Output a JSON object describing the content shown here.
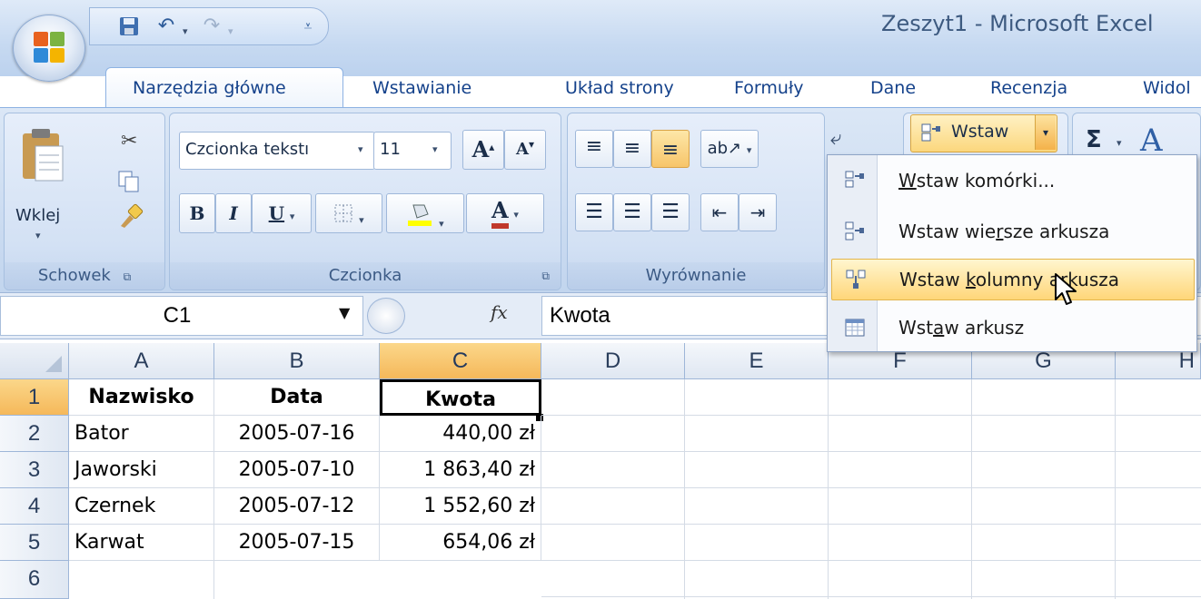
{
  "window": {
    "title": "Zeszyt1 - Microsoft Excel"
  },
  "quick_access": {
    "save_icon": "save-icon",
    "undo_icon": "undo-icon",
    "redo_icon": "redo-icon",
    "customize_icon": "customize-arrow-icon"
  },
  "tabs": [
    "Narzędzia główne",
    "Wstawianie",
    "Układ strony",
    "Formuły",
    "Dane",
    "Recenzja",
    "Widok"
  ],
  "tabs_visible": [
    "Narzędzia główne",
    "Wstawianie",
    "Układ strony",
    "Formuły",
    "Dane",
    "Recenzja",
    "Widol"
  ],
  "active_tab": "Narzędzia główne",
  "ribbon": {
    "clipboard": {
      "paste_label": "Wklej",
      "group_label": "Schowek"
    },
    "font": {
      "font_name": "Czcionka tekstu",
      "font_name_visible": "Czcionka tekstı",
      "font_size": "11",
      "bold": "B",
      "italic": "I",
      "underline": "U",
      "grow": "A",
      "shrink": "A",
      "font_color": "A",
      "group_label": "Czcionka"
    },
    "alignment": {
      "group_label": "Wyrównanie"
    },
    "cells": {
      "insert_label": "Wstaw"
    },
    "editing": {
      "sum_symbol": "Σ"
    }
  },
  "formula_bar": {
    "name_box": "C1",
    "fx": "fx",
    "formula": "Kwota"
  },
  "columns": [
    "A",
    "B",
    "C",
    "D",
    "E",
    "F",
    "G",
    "H"
  ],
  "selected_column": "C",
  "rows": [
    {
      "num": "1",
      "cells": [
        "Nazwisko",
        "Data",
        "Kwota"
      ]
    },
    {
      "num": "2",
      "cells": [
        "Bator",
        "2005-07-16",
        "440,00 zł"
      ]
    },
    {
      "num": "3",
      "cells": [
        "Jaworski",
        "2005-07-10",
        "1 863,40 zł"
      ]
    },
    {
      "num": "4",
      "cells": [
        "Czernek",
        "2005-07-12",
        "1 552,60 zł"
      ]
    },
    {
      "num": "5",
      "cells": [
        "Karwat",
        "2005-07-15",
        "654,06 zł"
      ]
    },
    {
      "num": "6",
      "cells": [
        "",
        "",
        ""
      ]
    }
  ],
  "insert_menu": {
    "items": [
      {
        "pre": "",
        "u": "W",
        "post": "staw komórki..."
      },
      {
        "pre": "Wstaw wie",
        "u": "r",
        "post": "sze arkusza"
      },
      {
        "pre": "Wstaw ",
        "u": "k",
        "post": "olumny arkusza"
      },
      {
        "pre": "Wst",
        "u": "a",
        "post": "w arkusz"
      }
    ],
    "highlighted_index": 2
  },
  "colors": {
    "selection_orange": "#f5b85a",
    "ribbon_blue": "#c9daf0",
    "tab_text": "#15428b"
  }
}
